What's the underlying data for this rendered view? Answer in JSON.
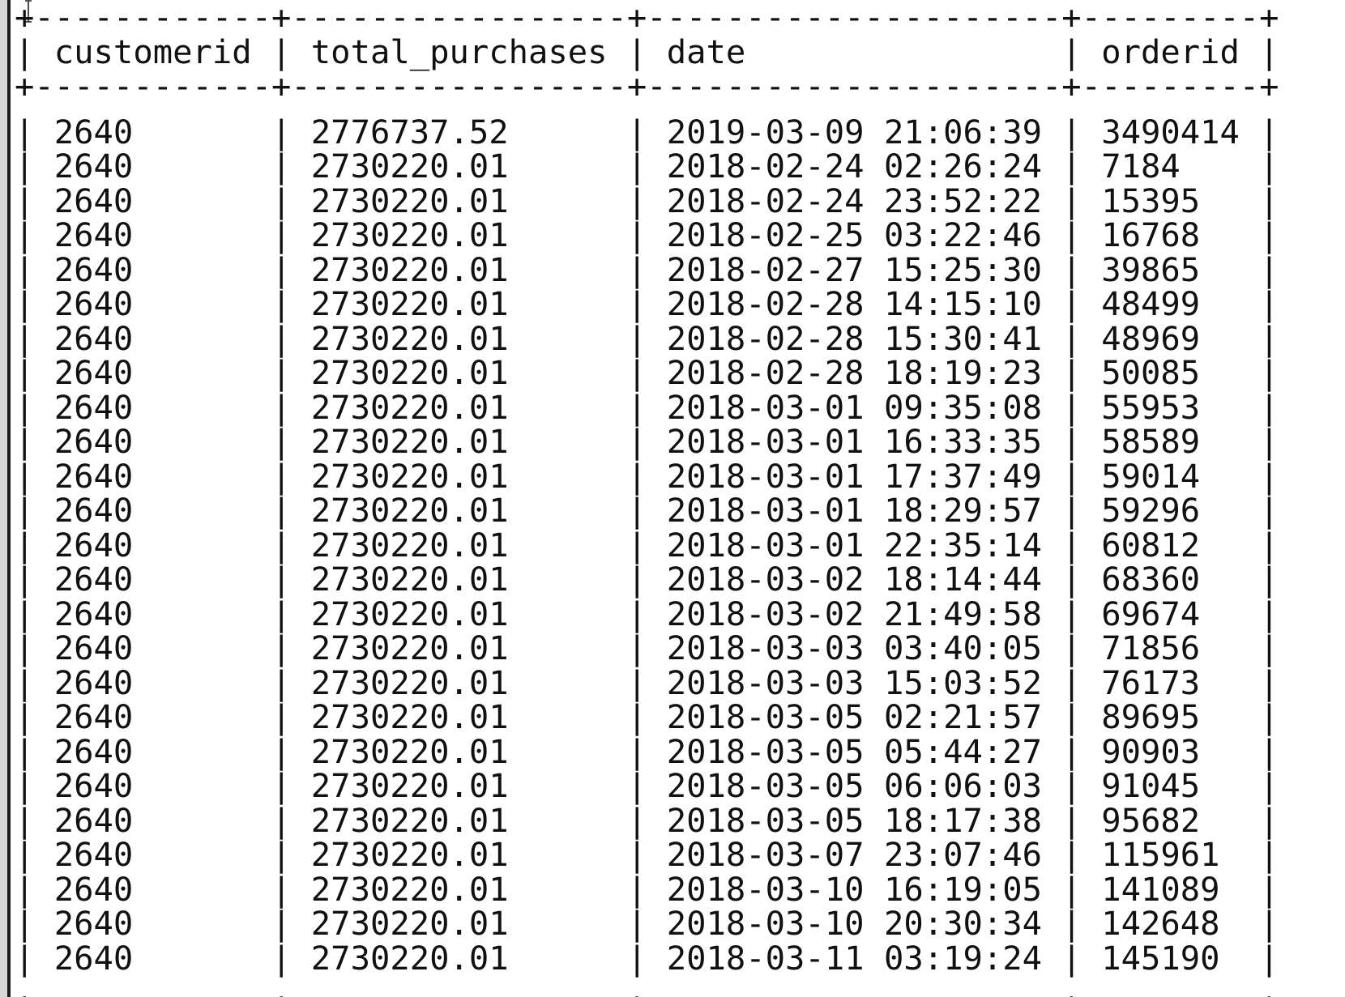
{
  "table": {
    "columns": [
      {
        "label": "customerid",
        "width": 12
      },
      {
        "label": "total_purchases",
        "width": 17
      },
      {
        "label": "date",
        "width": 21
      },
      {
        "label": "orderid",
        "width": 9
      }
    ],
    "rows": [
      [
        "2640",
        "2776737.52",
        "2019-03-09 21:06:39",
        "3490414"
      ],
      [
        "2640",
        "2730220.01",
        "2018-02-24 02:26:24",
        "7184"
      ],
      [
        "2640",
        "2730220.01",
        "2018-02-24 23:52:22",
        "15395"
      ],
      [
        "2640",
        "2730220.01",
        "2018-02-25 03:22:46",
        "16768"
      ],
      [
        "2640",
        "2730220.01",
        "2018-02-27 15:25:30",
        "39865"
      ],
      [
        "2640",
        "2730220.01",
        "2018-02-28 14:15:10",
        "48499"
      ],
      [
        "2640",
        "2730220.01",
        "2018-02-28 15:30:41",
        "48969"
      ],
      [
        "2640",
        "2730220.01",
        "2018-02-28 18:19:23",
        "50085"
      ],
      [
        "2640",
        "2730220.01",
        "2018-03-01 09:35:08",
        "55953"
      ],
      [
        "2640",
        "2730220.01",
        "2018-03-01 16:33:35",
        "58589"
      ],
      [
        "2640",
        "2730220.01",
        "2018-03-01 17:37:49",
        "59014"
      ],
      [
        "2640",
        "2730220.01",
        "2018-03-01 18:29:57",
        "59296"
      ],
      [
        "2640",
        "2730220.01",
        "2018-03-01 22:35:14",
        "60812"
      ],
      [
        "2640",
        "2730220.01",
        "2018-03-02 18:14:44",
        "68360"
      ],
      [
        "2640",
        "2730220.01",
        "2018-03-02 21:49:58",
        "69674"
      ],
      [
        "2640",
        "2730220.01",
        "2018-03-03 03:40:05",
        "71856"
      ],
      [
        "2640",
        "2730220.01",
        "2018-03-03 15:03:52",
        "76173"
      ],
      [
        "2640",
        "2730220.01",
        "2018-03-05 02:21:57",
        "89695"
      ],
      [
        "2640",
        "2730220.01",
        "2018-03-05 05:44:27",
        "90903"
      ],
      [
        "2640",
        "2730220.01",
        "2018-03-05 06:06:03",
        "91045"
      ],
      [
        "2640",
        "2730220.01",
        "2018-03-05 18:17:38",
        "95682"
      ],
      [
        "2640",
        "2730220.01",
        "2018-03-07 23:07:46",
        "115961"
      ],
      [
        "2640",
        "2730220.01",
        "2018-03-10 16:19:05",
        "141089"
      ],
      [
        "2640",
        "2730220.01",
        "2018-03-10 20:30:34",
        "142648"
      ],
      [
        "2640",
        "2730220.01",
        "2018-03-11 03:19:24",
        "145190"
      ]
    ]
  },
  "icons": {
    "cursor": "text-cursor-icon"
  }
}
